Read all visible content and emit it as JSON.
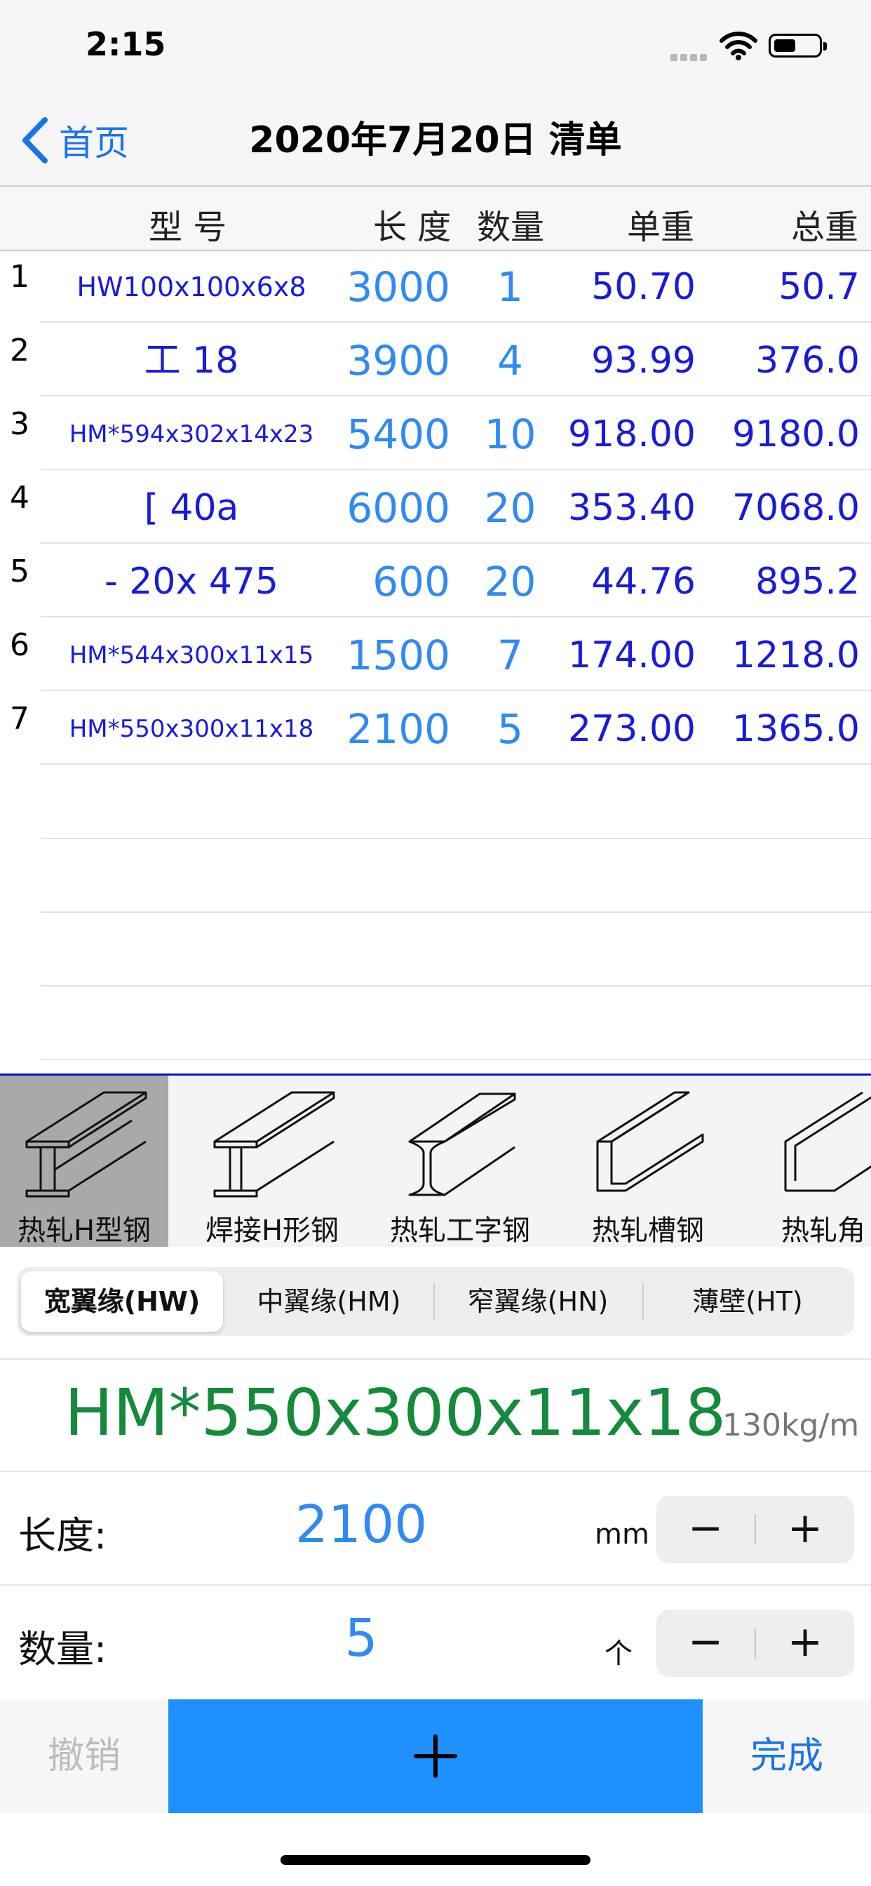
{
  "status_bar": {
    "time": "2:15"
  },
  "nav": {
    "back_label": "首页",
    "title": "2020年7月20日 清单"
  },
  "table": {
    "columns": [
      "型 号",
      "长 度",
      "数量",
      "单重",
      "总重"
    ],
    "rows": [
      {
        "index": "1",
        "model": "HW100x100x6x8",
        "length": "3000",
        "qty": "1",
        "unit_weight": "50.70",
        "total_weight": "50.7"
      },
      {
        "index": "2",
        "model": "工  18",
        "length": "3900",
        "qty": "4",
        "unit_weight": "93.99",
        "total_weight": "376.0"
      },
      {
        "index": "3",
        "model": "HM*594x302x14x23",
        "length": "5400",
        "qty": "10",
        "unit_weight": "918.00",
        "total_weight": "9180.0"
      },
      {
        "index": "4",
        "model": "[  40a",
        "length": "6000",
        "qty": "20",
        "unit_weight": "353.40",
        "total_weight": "7068.0"
      },
      {
        "index": "5",
        "model": "- 20x 475",
        "length": "600",
        "qty": "20",
        "unit_weight": "44.76",
        "total_weight": "895.2"
      },
      {
        "index": "6",
        "model": "HM*544x300x11x15",
        "length": "1500",
        "qty": "7",
        "unit_weight": "174.00",
        "total_weight": "1218.0"
      },
      {
        "index": "7",
        "model": "HM*550x300x11x18",
        "length": "2100",
        "qty": "5",
        "unit_weight": "273.00",
        "total_weight": "1365.0"
      }
    ]
  },
  "steel_types": [
    {
      "label": "热轧H型钢",
      "icon": "h-beam-icon",
      "selected": true
    },
    {
      "label": "焊接H形钢",
      "icon": "welded-h-beam-icon",
      "selected": false
    },
    {
      "label": "热轧工字钢",
      "icon": "i-beam-icon",
      "selected": false
    },
    {
      "label": "热轧槽钢",
      "icon": "channel-icon",
      "selected": false
    },
    {
      "label": "热轧角",
      "icon": "angle-icon",
      "selected": false
    }
  ],
  "flange_segments": [
    {
      "label": "宽翼缘(HW)",
      "selected": true
    },
    {
      "label": "中翼缘(HM)",
      "selected": false
    },
    {
      "label": "窄翼缘(HN)",
      "selected": false
    },
    {
      "label": "薄壁(HT)",
      "selected": false
    }
  ],
  "spec": {
    "value": "HM*550x300x11x18",
    "weight": "130kg/m"
  },
  "length_field": {
    "label": "长度:",
    "value": "2100",
    "unit": "mm",
    "minus": "−",
    "plus": "+"
  },
  "qty_field": {
    "label": "数量:",
    "value": "5",
    "unit": "个",
    "minus": "−",
    "plus": "+"
  },
  "toolbar": {
    "undo_label": "撤销",
    "done_label": "完成"
  },
  "colors": {
    "accent": "#1e90ff",
    "spec_green": "#148a3a",
    "row_text": "#1a1adb",
    "selected_type_bg": "#a9a9a9"
  }
}
